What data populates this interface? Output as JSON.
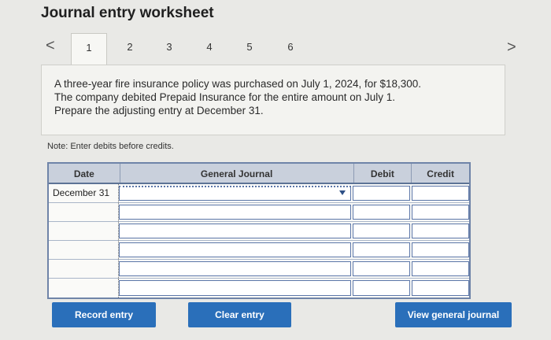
{
  "page": {
    "title": "Journal entry worksheet"
  },
  "tabs": {
    "prev_label": "<",
    "next_label": ">",
    "items": [
      "1",
      "2",
      "3",
      "4",
      "5",
      "6"
    ],
    "active": "1"
  },
  "question": {
    "line1": "A three-year fire insurance policy was purchased on July 1, 2024, for $18,300.",
    "line2": "The company debited Prepaid Insurance for the entire amount on July 1.",
    "line3": "Prepare the adjusting entry at December 31."
  },
  "note": "Note: Enter debits before credits.",
  "journal": {
    "headers": {
      "date": "Date",
      "general_journal": "General Journal",
      "debit": "Debit",
      "credit": "Credit"
    },
    "rows": [
      {
        "date": "December 31",
        "account": "",
        "debit": "",
        "credit": ""
      },
      {
        "date": "",
        "account": "",
        "debit": "",
        "credit": ""
      },
      {
        "date": "",
        "account": "",
        "debit": "",
        "credit": ""
      },
      {
        "date": "",
        "account": "",
        "debit": "",
        "credit": ""
      },
      {
        "date": "",
        "account": "",
        "debit": "",
        "credit": ""
      },
      {
        "date": "",
        "account": "",
        "debit": "",
        "credit": ""
      }
    ]
  },
  "buttons": {
    "record": "Record entry",
    "clear": "Clear entry",
    "view": "View general journal"
  }
}
